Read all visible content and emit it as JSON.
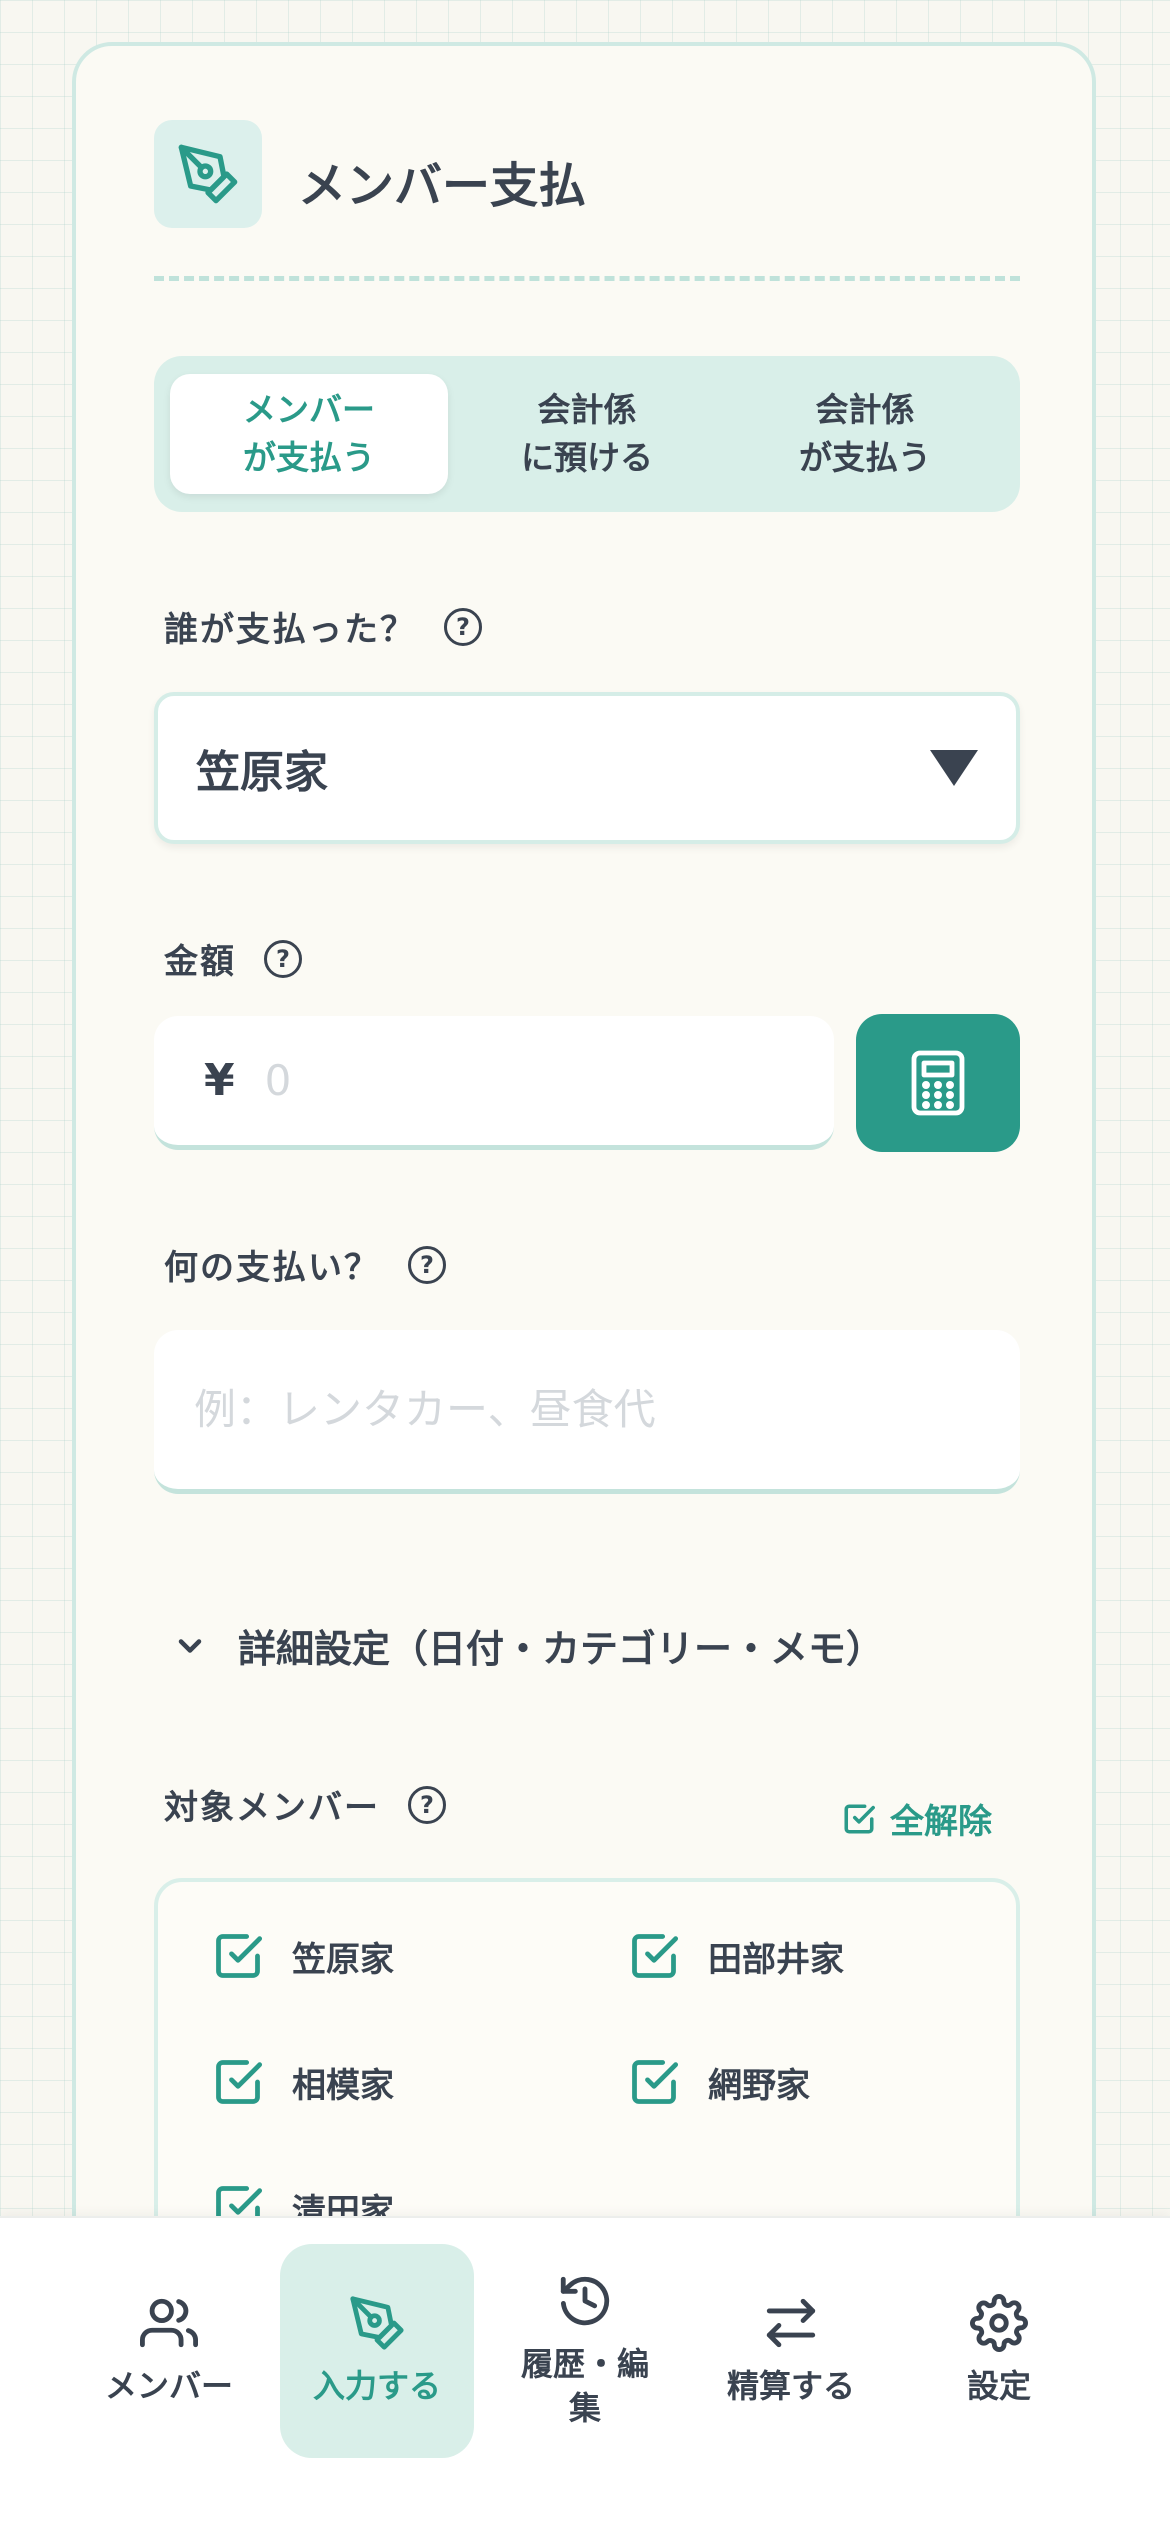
{
  "header": {
    "title": "メンバー支払",
    "icon": "pen-nib-icon"
  },
  "mode_tabs": [
    {
      "label_line1": "メンバー",
      "label_line2": "が支払う",
      "active": true
    },
    {
      "label_line1": "会計係",
      "label_line2": "に預ける",
      "active": false
    },
    {
      "label_line1": "会計係",
      "label_line2": "が支払う",
      "active": false
    }
  ],
  "payer": {
    "label": "誰が支払った？",
    "help": "?",
    "selected": "笠原家"
  },
  "amount": {
    "label": "金額",
    "help": "?",
    "currency": "¥",
    "placeholder": "0",
    "calculator_icon": "calculator-icon"
  },
  "description": {
    "label": "何の支払い？",
    "help": "?",
    "placeholder": "例：レンタカー、昼食代"
  },
  "details": {
    "label": "詳細設定（日付・カテゴリー・メモ）"
  },
  "targets": {
    "label": "対象メンバー",
    "help": "?",
    "clear_all": "全解除",
    "members": [
      {
        "name": "笠原家",
        "checked": true
      },
      {
        "name": "田部井家",
        "checked": true
      },
      {
        "name": "相模家",
        "checked": true
      },
      {
        "name": "網野家",
        "checked": true
      },
      {
        "name": "清田家",
        "checked": true
      }
    ]
  },
  "nav": [
    {
      "label": "メンバー",
      "icon": "users-icon",
      "active": false
    },
    {
      "label": "入力する",
      "icon": "pen-nib-icon",
      "active": true
    },
    {
      "label_line1": "履歴・編",
      "label_line2": "集",
      "icon": "history-icon",
      "active": false
    },
    {
      "label": "精算する",
      "icon": "swap-icon",
      "active": false
    },
    {
      "label": "設定",
      "icon": "gear-icon",
      "active": false
    }
  ],
  "colors": {
    "accent": "#2a9a89",
    "accent_light": "#d9efe9",
    "text": "#3a4350",
    "background": "#f8f7f1"
  }
}
